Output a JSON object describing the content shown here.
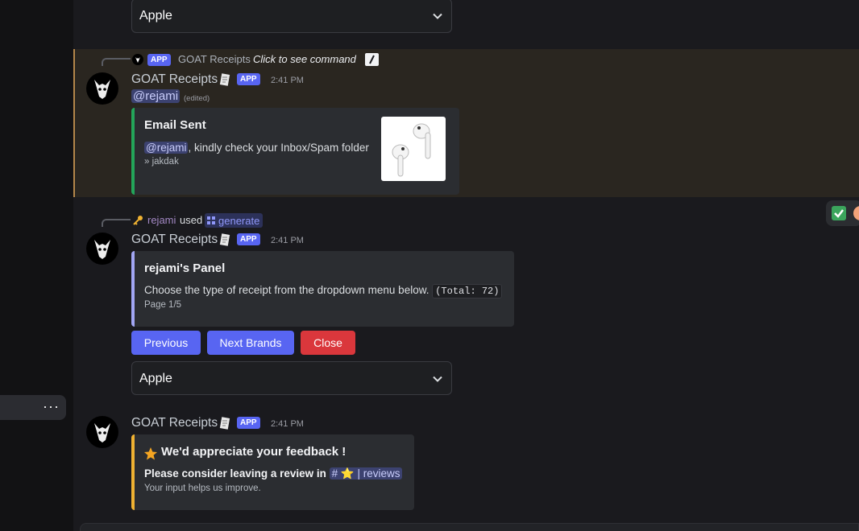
{
  "top_select": {
    "value": "Apple"
  },
  "message1": {
    "reply": {
      "app_badge": "APP",
      "bot_name": "GOAT Receipts",
      "command_hint": "Click to see command"
    },
    "author": "GOAT Receipts",
    "app_badge": "APP",
    "timestamp": "2:41 PM",
    "mention": "@rejami",
    "edited": "(edited)",
    "embed": {
      "title": "Email Sent",
      "mention": "@rejami",
      "description": ", kindly check your Inbox/Spam folder",
      "footer": "» jakdak"
    }
  },
  "message2": {
    "reply": {
      "user": "rejami",
      "used": "used",
      "command": "generate"
    },
    "author": "GOAT Receipts",
    "app_badge": "APP",
    "timestamp": "2:41 PM",
    "embed": {
      "title": "rejami's Panel",
      "description": "Choose the type of receipt from the dropdown menu below.",
      "code": "(Total: 72)",
      "footer": "Page 1/5"
    },
    "buttons": {
      "previous": "Previous",
      "next": "Next Brands",
      "close": "Close"
    },
    "select": {
      "value": "Apple"
    }
  },
  "message3": {
    "author": "GOAT Receipts",
    "app_badge": "APP",
    "timestamp": "2:41 PM",
    "embed": {
      "title": "We'd appreciate your feedback !",
      "line1": "Please consider leaving a review in",
      "channel": "# ⭐ | reviews",
      "footer": "Your input helps us improve."
    }
  },
  "sidebar": {
    "more_label": "···"
  },
  "colors": {
    "accent": "#5865f2",
    "danger": "#da373c",
    "embed_green": "#23a55a",
    "embed_lavender": "#a2a6f4",
    "embed_yellow": "#f0b232",
    "highlight_border": "#b3864a"
  }
}
